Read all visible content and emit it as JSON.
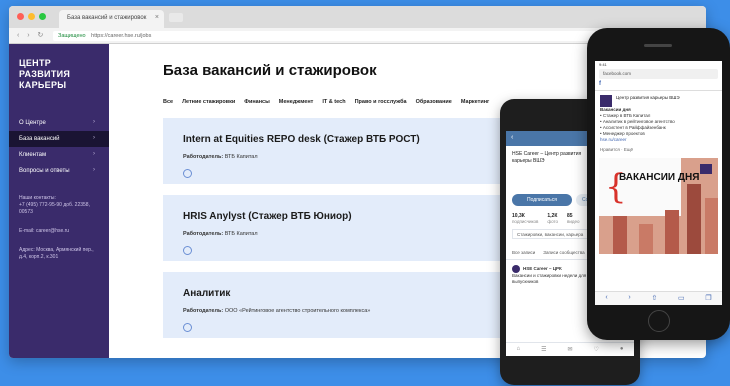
{
  "browser": {
    "tab_title": "База вакансий и стажировок",
    "tab_close": "×",
    "nav_glyphs": "‹ › ↻",
    "secure_label": "Защищено",
    "url": "https://career.hse.ru/jobs",
    "dot_colors": [
      "#ff5f57",
      "#febc2e",
      "#28c840"
    ]
  },
  "sidebar": {
    "logo": "ЦЕНТР РАЗВИТИЯ КАРЬЕРЫ",
    "items": [
      {
        "label": "О Центре",
        "chev": "›"
      },
      {
        "label": "База вакансий",
        "chev": "›"
      },
      {
        "label": "Клиентам",
        "chev": "›"
      },
      {
        "label": "Вопросы и ответы",
        "chev": "›"
      }
    ],
    "contacts": {
      "phone_label": "Наши контакты:",
      "phone": "+7 (495) 772-95-90 доб. 22358, 00573",
      "email": "E-mail: career@hse.ru",
      "address": "Адрес: Москва, Армянский пер., д.4, корп.2, к.301"
    }
  },
  "main": {
    "title": "База вакансий и стажировок",
    "filters": [
      "Все",
      "Летние стажировки",
      "Финансы",
      "Менеджмент",
      "IT & tech",
      "Право и госслужба",
      "Образование",
      "Маркетинг"
    ],
    "cards": [
      {
        "title": "Intern at Equities REPO desk (Стажер ВТБ РОСТ)",
        "employer_label": "Работодатель:",
        "employer": "ВТБ Капитал"
      },
      {
        "title": "HRIS Anylyst (Стажер ВТБ Юниор)",
        "employer_label": "Работодатель:",
        "employer": "ВТБ Капитал"
      },
      {
        "title": "Аналитик",
        "employer_label": "Работодатель:",
        "employer": "ООО «Рейтинговое агентство строительного комплекса»"
      }
    ]
  },
  "phone_vk": {
    "back": "‹",
    "name": "HSE Career – Центр развития карьеры ВШЭ",
    "btn_primary": "Подписаться",
    "btn_secondary": "Сообщение",
    "stats": [
      {
        "value": "10,3К",
        "label": "подписчиков"
      },
      {
        "value": "1,2К",
        "label": "фото"
      },
      {
        "value": "85",
        "label": "видео"
      }
    ],
    "info": "Стажировки, вакансии, карьера",
    "tabs": [
      "Все записи",
      "Записи сообщества"
    ],
    "post_author": "HSE Career – ЦРК",
    "post_text": "Вакансии и стажировки недели для студентов и выпускников",
    "nav": [
      "⌂",
      "☰",
      "✉",
      "♡",
      "●"
    ]
  },
  "phone_fb": {
    "status": "9:41",
    "url": "facebook.com",
    "brand": "f",
    "page_name": "Центр развития карьеры ВШЭ",
    "post_heading": "Вакансии дня",
    "post_lines": [
      "• Стажер в ВТБ Капитал",
      "• Аналитик в рейтинговое агентство",
      "• Ассистент в Райффайзенбанк",
      "• Менеджер проектов"
    ],
    "link": "hse.ru/career",
    "like": "Нравится · Ещё",
    "image_brace": "{",
    "image_word": "ВАКАНСИИ ДНЯ",
    "nav": [
      "‹",
      "›",
      "⇧",
      "▭",
      "❐"
    ]
  }
}
